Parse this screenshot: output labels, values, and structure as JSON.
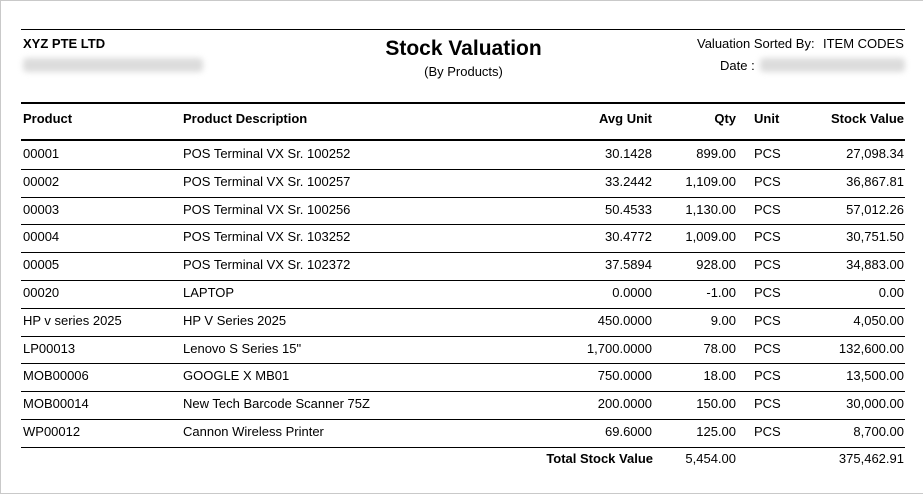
{
  "header": {
    "company": "XYZ PTE LTD",
    "title": "Stock Valuation",
    "subtitle": "(By Products)",
    "sorted_label": "Valuation Sorted By:",
    "sorted_value": "ITEM CODES",
    "date_label": "Date :"
  },
  "columns": {
    "product": "Product",
    "description": "Product Description",
    "avg_unit": "Avg Unit",
    "qty": "Qty",
    "unit": "Unit",
    "stock_value": "Stock Value"
  },
  "rows": [
    {
      "product": "00001",
      "description": "POS Terminal VX Sr. 100252",
      "avg_unit": "30.1428",
      "qty": "899.00",
      "unit": "PCS",
      "stock_value": "27,098.34"
    },
    {
      "product": "00002",
      "description": "POS Terminal VX Sr. 100257",
      "avg_unit": "33.2442",
      "qty": "1,109.00",
      "unit": "PCS",
      "stock_value": "36,867.81"
    },
    {
      "product": "00003",
      "description": "POS Terminal VX Sr. 100256",
      "avg_unit": "50.4533",
      "qty": "1,130.00",
      "unit": "PCS",
      "stock_value": "57,012.26"
    },
    {
      "product": "00004",
      "description": "POS Terminal VX Sr. 103252",
      "avg_unit": "30.4772",
      "qty": "1,009.00",
      "unit": "PCS",
      "stock_value": "30,751.50"
    },
    {
      "product": "00005",
      "description": "POS Terminal VX Sr. 102372",
      "avg_unit": "37.5894",
      "qty": "928.00",
      "unit": "PCS",
      "stock_value": "34,883.00"
    },
    {
      "product": "00020",
      "description": "LAPTOP",
      "avg_unit": "0.0000",
      "qty": "-1.00",
      "unit": "PCS",
      "stock_value": "0.00"
    },
    {
      "product": "HP v series 2025",
      "description": "HP V Series 2025",
      "avg_unit": "450.0000",
      "qty": "9.00",
      "unit": "PCS",
      "stock_value": "4,050.00"
    },
    {
      "product": "LP00013",
      "description": "Lenovo S Series 15\"",
      "avg_unit": "1,700.0000",
      "qty": "78.00",
      "unit": "PCS",
      "stock_value": "132,600.00"
    },
    {
      "product": "MOB00006",
      "description": "GOOGLE X MB01",
      "avg_unit": "750.0000",
      "qty": "18.00",
      "unit": "PCS",
      "stock_value": "13,500.00"
    },
    {
      "product": "MOB00014",
      "description": "New Tech Barcode Scanner 75Z",
      "avg_unit": "200.0000",
      "qty": "150.00",
      "unit": "PCS",
      "stock_value": "30,000.00"
    },
    {
      "product": "WP00012",
      "description": "Cannon Wireless Printer",
      "avg_unit": "69.6000",
      "qty": "125.00",
      "unit": "PCS",
      "stock_value": "8,700.00"
    }
  ],
  "total": {
    "label": "Total Stock Value",
    "qty": "5,454.00",
    "stock_value": "375,462.91"
  }
}
